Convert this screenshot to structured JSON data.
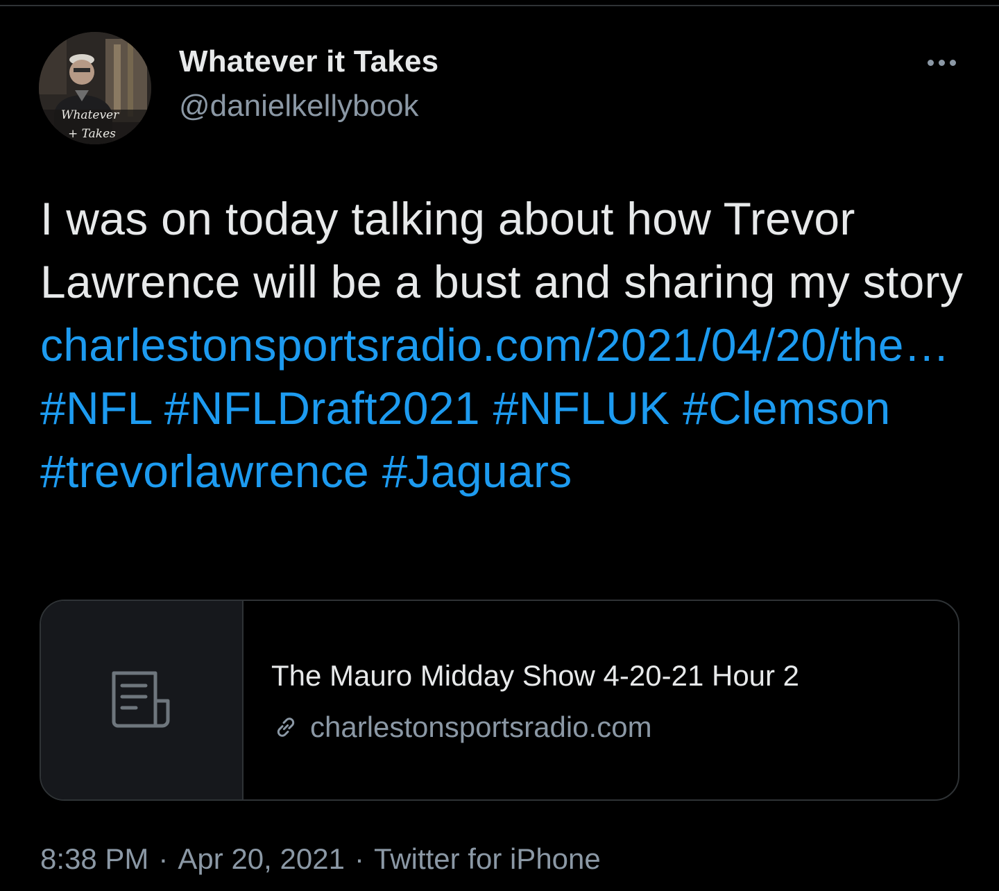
{
  "colors": {
    "background": "#000000",
    "text": "#e7e9ea",
    "secondary_text": "#8b98a5",
    "link": "#1d9bf0",
    "border": "#2f3336"
  },
  "author": {
    "display_name": "Whatever it Takes",
    "handle": "@danielkellybook",
    "avatar_caption_line1": "Whatever",
    "avatar_caption_line2": "+ Takes"
  },
  "more_icon": "ellipsis-icon",
  "tweet": {
    "text_line1": "I was on today talking about how",
    "text_line2": "Trevor Lawrence will be a bust and",
    "text_line3": "sharing my story",
    "link_text": "charlestonsportsradio.com/2021/04/20/the…",
    "hashtags": [
      "#NFL",
      "#NFLDraft2021",
      "#NFLUK",
      "#Clemson",
      "#trevorlawrence",
      "#Jaguars"
    ]
  },
  "card": {
    "icon": "article-icon",
    "title": "The Mauro Midday Show 4-20-21 Hour 2",
    "domain_icon": "link-icon",
    "domain": "charlestonsportsradio.com"
  },
  "meta": {
    "time": "8:38 PM",
    "date": "Apr 20, 2021",
    "source": "Twitter for iPhone",
    "separator": "·"
  }
}
